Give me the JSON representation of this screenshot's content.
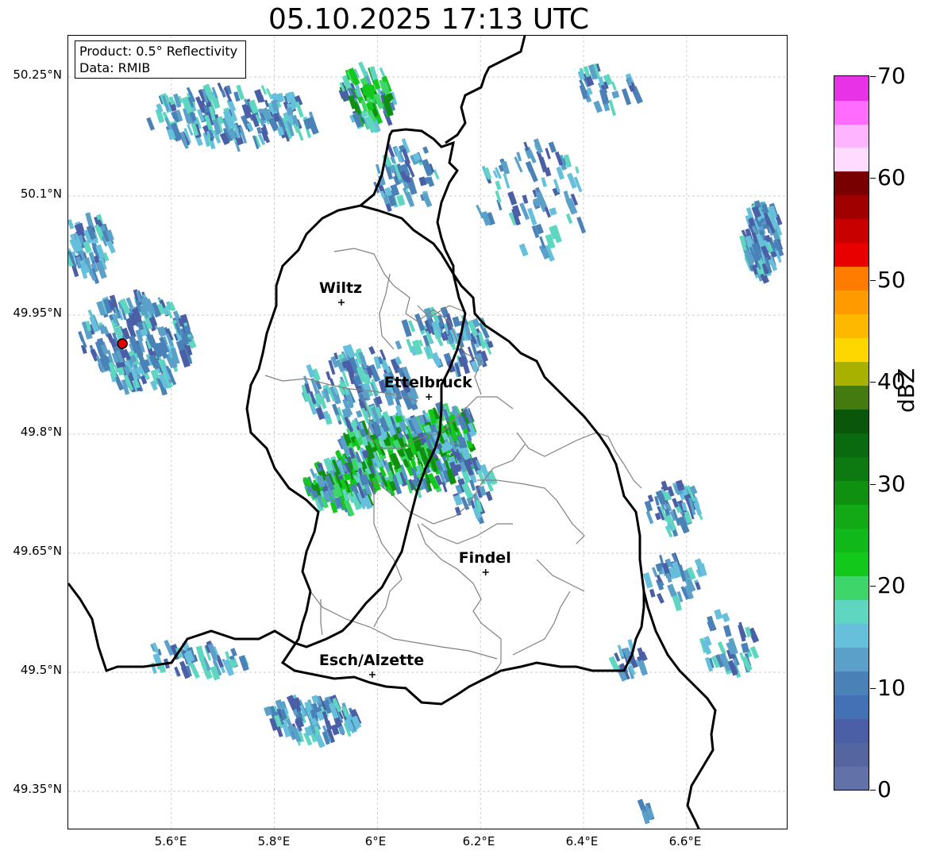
{
  "title": "05.10.2025 17:13 UTC",
  "info": {
    "product": "Product: 0.5° Reflectivity",
    "data": "Data: RMIB"
  },
  "map": {
    "lon_range": [
      5.4,
      6.8
    ],
    "lat_range": [
      49.3,
      50.3
    ],
    "lat_ticks": [
      "50.25°N",
      "50.1°N",
      "49.95°N",
      "49.8°N",
      "49.65°N",
      "49.5°N",
      "49.35°N"
    ],
    "lon_ticks": [
      "5.6°E",
      "5.8°E",
      "6°E",
      "6.2°E",
      "6.4°E",
      "6.6°E"
    ],
    "cities": [
      {
        "name": "Wiltz",
        "lon": 5.93,
        "lat": 49.966
      },
      {
        "name": "Ettelbruck",
        "lon": 6.1,
        "lat": 49.847
      },
      {
        "name": "Findel",
        "lon": 6.21,
        "lat": 49.626
      },
      {
        "name": "Esch/Alzette",
        "lon": 5.99,
        "lat": 49.497
      }
    ],
    "radar_site": {
      "lon": 5.505,
      "lat": 49.914
    },
    "grid": true
  },
  "colorbar": {
    "label": "dBZ",
    "ticks": [
      "70",
      "60",
      "50",
      "40",
      "30",
      "20",
      "10",
      "0"
    ],
    "levels": [
      "#6272a8",
      "#5565a0",
      "#4a5fa5",
      "#4470b5",
      "#4a82b8",
      "#5aa0c8",
      "#66c0dc",
      "#5fd6c0",
      "#3ed66a",
      "#12c81a",
      "#10b81a",
      "#12a816",
      "#0f9010",
      "#0c7a10",
      "#0a6a10",
      "#0a560a",
      "#457a10",
      "#a8b000",
      "#ffd700",
      "#ffb800",
      "#ff9a00",
      "#ff7c00",
      "#e80000",
      "#c80000",
      "#a00000",
      "#780000",
      "#ffdcff",
      "#ffb4ff",
      "#ff6cff",
      "#e832e8"
    ]
  },
  "echo_colors": [
    "#4a5fa5",
    "#4a82b8",
    "#5aa0c8",
    "#66c0dc",
    "#5fd6c0",
    "#3ed66a",
    "#12c81a",
    "#0f9010",
    "#a8b000"
  ]
}
